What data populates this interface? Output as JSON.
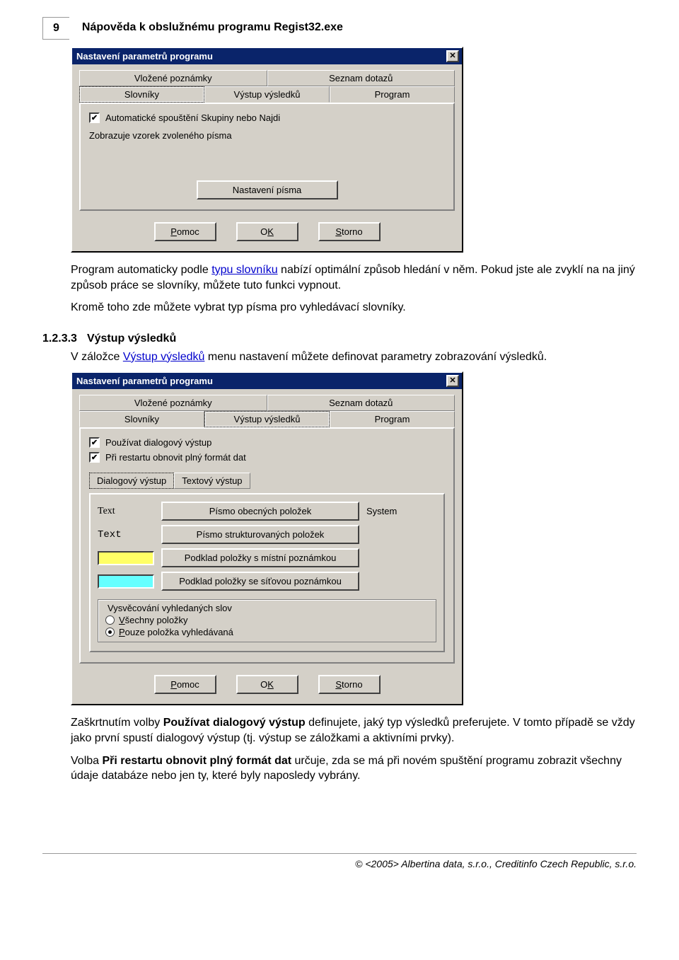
{
  "page": {
    "number": "9",
    "title": "Nápověda k obslužnému programu Regist32.exe"
  },
  "dialog1": {
    "title": "Nastavení parametrů programu",
    "tabsBack": [
      "Vložené poznámky",
      "Seznam dotazů"
    ],
    "tabsFront": [
      "Slovníky",
      "Výstup výsledků",
      "Program"
    ],
    "activeFront": 0,
    "checkbox": {
      "checked": true,
      "label": "Automatické spouštění Skupiny nebo Najdi"
    },
    "fontSampleLabel": "Zobrazuje vzorek zvoleného písma",
    "fontButton": "Nastavení písma",
    "buttons": {
      "help_u": "P",
      "help_rest": "omoc",
      "ok_u": "K",
      "ok_pre": "O",
      "cancel_u": "S",
      "cancel_rest": "torno"
    }
  },
  "para1_pre": "Program automaticky podle ",
  "para1_link": "typu slovníku",
  "para1_post": " nabízí optimální způsob hledání v něm. Pokud jste ale zvyklí na na jiný způsob práce se slovníky, můžete tuto funkci vypnout.",
  "para2": "Kromě toho zde můžete vybrat typ písma pro vyhledávací slovníky.",
  "section": {
    "num": "1.2.3.3",
    "title": "Výstup výsledků"
  },
  "para3_pre": "V záložce ",
  "para3_link": "Výstup výsledků",
  "para3_post": " menu nastavení můžete definovat parametry zobrazování výsledků.",
  "dialog2": {
    "title": "Nastavení parametrů programu",
    "tabsBack": [
      "Vložené poznámky",
      "Seznam dotazů"
    ],
    "tabsFront": [
      "Slovníky",
      "Výstup výsledků",
      "Program"
    ],
    "activeFront": 1,
    "check1": {
      "checked": true,
      "label": "Používat dialogový výstup"
    },
    "check2": {
      "checked": true,
      "label": "Při restartu obnovit plný formát dat"
    },
    "subtabs": [
      "Dialogový výstup",
      "Textový výstup"
    ],
    "rows": [
      {
        "kind": "text",
        "sample": "Text",
        "button": "Písmo obecných položek",
        "trail": "System"
      },
      {
        "kind": "text",
        "sample": "Text",
        "button": "Písmo strukturovaných položek",
        "trail": ""
      },
      {
        "kind": "swatch",
        "color": "#ffff66",
        "button": "Podklad položky s místní poznámkou",
        "trail": ""
      },
      {
        "kind": "swatch",
        "color": "#66ffff",
        "button": "Podklad položky se síťovou poznámkou",
        "trail": ""
      }
    ],
    "group": {
      "legend": "Vysvěcování vyhledaných slov",
      "radios": [
        {
          "label_u": "V",
          "label_rest": "šechny položky",
          "checked": false
        },
        {
          "label_u": "P",
          "label_rest": "ouze položka vyhledávaná",
          "checked": true
        }
      ]
    },
    "buttons": {
      "help_u": "P",
      "help_rest": "omoc",
      "ok_u": "K",
      "ok_pre": "O",
      "cancel_u": "S",
      "cancel_rest": "torno"
    }
  },
  "para4_pre": "Zaškrtnutím volby ",
  "para4_bold": "Používat dialogový výstup",
  "para4_post": " definujete, jaký typ výsledků preferujete. V tomto případě se vždy jako první spustí dialogový výstup (tj. výstup se záložkami a aktivními prvky).",
  "para5_pre": "Volba ",
  "para5_bold": "Při restartu obnovit plný formát dat",
  "para5_post": " určuje, zda se má při novém spuštění programu zobrazit všechny údaje databáze nebo jen ty, které byly naposledy vybrány.",
  "footer": "© <2005> Albertina data, s.r.o., Creditinfo Czech Republic, s.r.o."
}
